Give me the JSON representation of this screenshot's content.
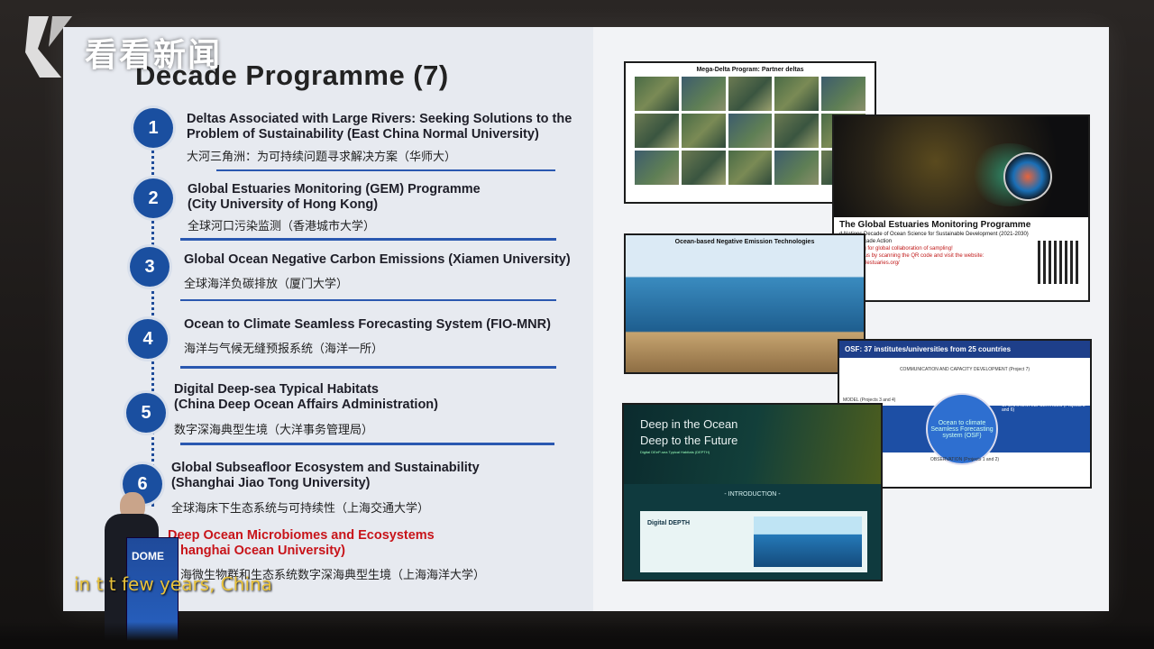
{
  "watermark": {
    "text": "看看新闻"
  },
  "slide": {
    "title": "Decade Programme (7)",
    "items": [
      {
        "num": "1",
        "en_1": "Deltas Associated with Large Rivers: Seeking Solutions to the",
        "en_2": "Problem of Sustainability (East China Normal University)",
        "zh": "大河三角洲：为可持续问题寻求解决方案（华师大）"
      },
      {
        "num": "2",
        "en_1": "Global Estuaries Monitoring (GEM) Programme",
        "en_2": "(City University of Hong Kong)",
        "zh": "全球河口污染监测（香港城市大学）"
      },
      {
        "num": "3",
        "en_1": "Global Ocean Negative Carbon Emissions (Xiamen University)",
        "en_2": "",
        "zh": "全球海洋负碳排放（厦门大学）"
      },
      {
        "num": "4",
        "en_1": "Ocean to Climate Seamless Forecasting System (FIO-MNR)",
        "en_2": "",
        "zh": "海洋与气候无缝预报系统（海洋一所）"
      },
      {
        "num": "5",
        "en_1": "Digital Deep-sea Typical Habitats",
        "en_2": "(China Deep Ocean Affairs Administration)",
        "zh": "数字深海典型生境（大洋事务管理局）"
      },
      {
        "num": "6",
        "en_1": "Global Subseafloor Ecosystem and Sustainability",
        "en_2": "(Shanghai Jiao Tong University)",
        "zh": "全球海床下生态系统与可持续性（上海交通大学）"
      },
      {
        "num": "7",
        "en_1": "Deep Ocean Microbiomes and Ecosystems",
        "en_2": "hanghai Ocean University)",
        "zh": "海微生物群和生态系统数字深海典型生境（上海海洋大学）"
      }
    ]
  },
  "thumbs": {
    "delta_title": "Mega-Delta Program: Partner deltas",
    "gem_title": "The Global Estuaries Monitoring Programme",
    "gem_sub1": "d Nations Decade of Ocean Science for Sustainable Development (2021-2030)",
    "gem_sub2": "Ocean Decade Action",
    "gem_sub3": "now calling for global collaboration of sampling!",
    "gem_sub4": "e and join us by scanning the QR code and visit the website:",
    "gem_sub5": "www.globalestuaries.org/",
    "neg_title": "Ocean-based Negative Emission Technologies",
    "osf_head": "OSF: 37 institutes/universities from 25 countries",
    "osf_circle": "Ocean to climate Seamless Forecasting system (OSF)",
    "osf_cap": "COMMUNICATION AND CAPACITY DEVELOPMENT (Project 7)",
    "osf_ops": "OPERATION AND SERVICES (Projects 5 and 6)",
    "osf_model": "MODEL (Projects 3 and 4)",
    "osf_obs": "OBSERVATION (Projects 1 and 2)",
    "deep_t1": "Deep in the Ocean",
    "deep_t2": "Deep to the Future",
    "deep_t3": "Digital DEeP-sea Typical Habitats (DEPTH)",
    "deep_intro": "- INTRODUCTION -",
    "deep_box_title": "Digital DEPTH"
  },
  "podium": {
    "label": "DOME"
  },
  "subtitle": "in t      t few years, China"
}
